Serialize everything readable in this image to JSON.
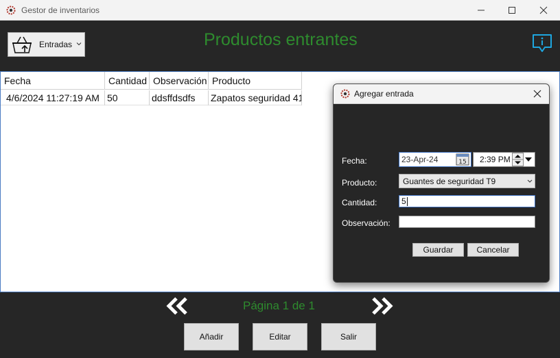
{
  "window": {
    "title": "Gestor de inventarios",
    "icon": "app-gear-icon"
  },
  "toolbar": {
    "section_dropdown_label": "Entradas",
    "section_icon": "basket-upload-icon",
    "page_title": "Productos entrantes",
    "info_icon": "info-chat-icon"
  },
  "grid": {
    "columns": [
      "Fecha",
      "Cantidad",
      "Observación",
      "Producto"
    ],
    "rows": [
      [
        "4/6/2024 11:27:19 AM",
        "50",
        "ddsffdsdfs",
        "Zapatos seguridad 41"
      ]
    ]
  },
  "pager": {
    "text": "Página 1 de 1",
    "prev_icon": "double-chevron-left-icon",
    "next_icon": "double-chevron-right-icon"
  },
  "actions": {
    "add_label": "Añadir",
    "edit_label": "Editar",
    "exit_label": "Salir"
  },
  "dialog": {
    "title": "Agregar entrada",
    "fecha_label": "Fecha:",
    "date_value": "23-Apr-24",
    "time_value": "2:39 PM",
    "calendar_icon_day": "15",
    "producto_label": "Producto:",
    "producto_value": "Guantes de seguridad T9",
    "cantidad_label": "Cantidad:",
    "cantidad_value": "5",
    "observacion_label": "Observación:",
    "observacion_value": "",
    "save_label": "Guardar",
    "cancel_label": "Cancelar"
  },
  "colors": {
    "accent_green": "#2e8b2e",
    "info_blue": "#1ea7e0",
    "background": "#262626"
  }
}
